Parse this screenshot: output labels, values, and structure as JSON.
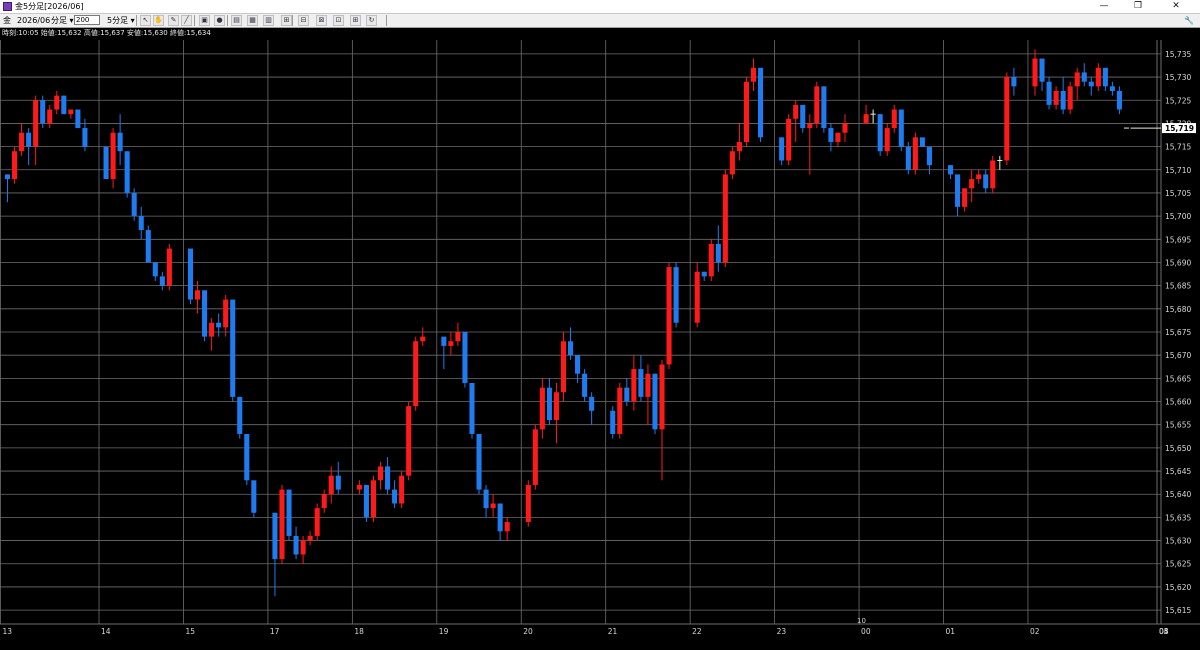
{
  "window": {
    "title": "金5分足[2026/06]",
    "minimize_glyph": "—",
    "maximize_glyph": "❐",
    "close_glyph": "✕"
  },
  "toolbar": {
    "symbol": "金",
    "contract": "2026/06",
    "unit_label": "分足",
    "count_value": "200",
    "timeframe_label": "5分足",
    "button_icons": [
      "cursor-icon",
      "hand-icon",
      "pen-icon",
      "line-draw-icon",
      "chart-select-icon",
      "color-circle-icon",
      "bar-chart-icon",
      "grid-icon",
      "table-icon",
      "indicator-icon",
      "indicator-icon-2",
      "indicator-icon-3",
      "indicator-icon-4",
      "indicator-icon-5",
      "refresh-icon"
    ],
    "settings_icon": "wrench-icon"
  },
  "info_bar": {
    "text": "時刻:10:05 始値:15,632 高値:15,637 安値:15,630 終値:15,634"
  },
  "colors": {
    "background": "#000000",
    "grid": "#6e6e6e",
    "up": "#ff1a1a",
    "down": "#1e7cf0",
    "doji": "#f0ead0",
    "axis_text": "#d8d8d8",
    "price_tag_bg": "#ffffff"
  },
  "chart_data": {
    "type": "candlestick",
    "y_axis": {
      "ticks": [
        15615,
        15620,
        15625,
        15630,
        15635,
        15640,
        15645,
        15650,
        15655,
        15660,
        15665,
        15670,
        15675,
        15680,
        15685,
        15690,
        15695,
        15700,
        15705,
        15710,
        15715,
        15720,
        15725,
        15730,
        15735
      ],
      "tick_labels": [
        "15,615",
        "15,620",
        "15,625",
        "15,630",
        "15,635",
        "15,640",
        "15,645",
        "15,650",
        "15,655",
        "15,660",
        "15,665",
        "15,670",
        "15,675",
        "15,680",
        "15,685",
        "15,690",
        "15,695",
        "15,700",
        "15,705",
        "15,710",
        "15,715",
        "15,720",
        "15,725",
        "15,730",
        "15,735"
      ],
      "range": [
        15612,
        15738
      ]
    },
    "x_axis": {
      "labels": [
        "13",
        "14",
        "15",
        "17",
        "18",
        "19",
        "20",
        "21",
        "22",
        "23",
        "00",
        "01",
        "02",
        "03",
        "04",
        "05"
      ],
      "month_marker": "10",
      "month_marker_at": "00",
      "grid_at": [
        "13",
        "14",
        "15",
        "17",
        "18",
        "19",
        "20",
        "21",
        "22",
        "23",
        "00",
        "01",
        "02",
        "03",
        "04",
        "05"
      ]
    },
    "current_price": 15719,
    "current_price_label": "15,719",
    "candles": [
      [
        15709,
        15709,
        15703,
        15708
      ],
      [
        15708,
        15715,
        15707,
        15714
      ],
      [
        15714,
        15720,
        15713,
        15718
      ],
      [
        15718,
        15719,
        15711,
        15715
      ],
      [
        15715,
        15726,
        15711,
        15725
      ],
      [
        15725,
        15726,
        15719,
        15720
      ],
      [
        15720,
        15724,
        15719,
        15723
      ],
      [
        15723,
        15727,
        15722,
        15726
      ],
      [
        15726,
        15726,
        15722,
        15722
      ],
      [
        15722,
        15723,
        15721,
        15723
      ],
      [
        15723,
        15723,
        15719,
        15719
      ],
      [
        15719,
        15721,
        15714,
        15715
      ],
      [
        15715,
        15715,
        15708,
        15708
      ],
      [
        15708,
        15719,
        15706,
        15718
      ],
      [
        15718,
        15722,
        15711,
        15714
      ],
      [
        15714,
        15714,
        15704,
        15705
      ],
      [
        15705,
        15706,
        15699,
        15700
      ],
      [
        15700,
        15702,
        15695,
        15697
      ],
      [
        15697,
        15698,
        15690,
        15690
      ],
      [
        15690,
        15690,
        15686,
        15687
      ],
      [
        15687,
        15688,
        15684,
        15685
      ],
      [
        15685,
        15694,
        15684,
        15693
      ],
      [
        15693,
        15693,
        15681,
        15682
      ],
      [
        15682,
        15686,
        15679,
        15684
      ],
      [
        15684,
        15684,
        15673,
        15674
      ],
      [
        15674,
        15678,
        15671,
        15677
      ],
      [
        15677,
        15679,
        15674,
        15676
      ],
      [
        15676,
        15683,
        15674,
        15682
      ],
      [
        15682,
        15682,
        15660,
        15661
      ],
      [
        15661,
        15661,
        15652,
        15653
      ],
      [
        15653,
        15653,
        15642,
        15643
      ],
      [
        15643,
        15643,
        15635,
        15636
      ],
      [
        15636,
        15636,
        15618,
        15626
      ],
      [
        15626,
        15642,
        15625,
        15641
      ],
      [
        15641,
        15641,
        15630,
        15631
      ],
      [
        15631,
        15633,
        15626,
        15627
      ],
      [
        15627,
        15631,
        15625,
        15630
      ],
      [
        15630,
        15632,
        15629,
        15631
      ],
      [
        15631,
        15638,
        15630,
        15637
      ],
      [
        15637,
        15641,
        15636,
        15640
      ],
      [
        15640,
        15646,
        15638,
        15644
      ],
      [
        15644,
        15647,
        15640,
        15641
      ],
      [
        15641,
        15643,
        15640,
        15642
      ],
      [
        15642,
        15642,
        15634,
        15635
      ],
      [
        15635,
        15644,
        15634,
        15643
      ],
      [
        15643,
        15647,
        15641,
        15646
      ],
      [
        15646,
        15648,
        15640,
        15641
      ],
      [
        15641,
        15643,
        15637,
        15638
      ],
      [
        15638,
        15645,
        15637,
        15644
      ],
      [
        15644,
        15660,
        15643,
        15659
      ],
      [
        15659,
        15674,
        15658,
        15673
      ],
      [
        15673,
        15676,
        15672,
        15674
      ],
      [
        15674,
        15674,
        15667,
        15672
      ],
      [
        15672,
        15675,
        15670,
        15673
      ],
      [
        15673,
        15677,
        15672,
        15675
      ],
      [
        15675,
        15675,
        15663,
        15664
      ],
      [
        15664,
        15664,
        15652,
        15653
      ],
      [
        15653,
        15653,
        15640,
        15641
      ],
      [
        15641,
        15642,
        15635,
        15637
      ],
      [
        15637,
        15640,
        15635,
        15638
      ],
      [
        15638,
        15638,
        15630,
        15632
      ],
      [
        15632,
        15635,
        15630,
        15634
      ],
      [
        15634,
        15643,
        15633,
        15642
      ],
      [
        15642,
        15655,
        15641,
        15654
      ],
      [
        15654,
        15665,
        15652,
        15663
      ],
      [
        15663,
        15665,
        15655,
        15656
      ],
      [
        15656,
        15664,
        15651,
        15662
      ],
      [
        15662,
        15675,
        15660,
        15673
      ],
      [
        15673,
        15676,
        15669,
        15670
      ],
      [
        15670,
        15670,
        15664,
        15666
      ],
      [
        15666,
        15667,
        15660,
        15661
      ],
      [
        15661,
        15662,
        15655,
        15658
      ],
      [
        15658,
        15659,
        15652,
        15653
      ],
      [
        15653,
        15664,
        15652,
        15663
      ],
      [
        15663,
        15665,
        15659,
        15660
      ],
      [
        15660,
        15670,
        15658,
        15667
      ],
      [
        15667,
        15670,
        15660,
        15661
      ],
      [
        15661,
        15668,
        15655,
        15666
      ],
      [
        15666,
        15666,
        15653,
        15654
      ],
      [
        15654,
        15669,
        15643,
        15668
      ],
      [
        15668,
        15690,
        15667,
        15689
      ],
      [
        15689,
        15690,
        15676,
        15677
      ],
      [
        15677,
        15690,
        15676,
        15688
      ],
      [
        15688,
        15688,
        15686,
        15687
      ],
      [
        15687,
        15695,
        15686,
        15694
      ],
      [
        15694,
        15698,
        15688,
        15690
      ],
      [
        15690,
        15710,
        15689,
        15709
      ],
      [
        15709,
        15715,
        15708,
        15714
      ],
      [
        15714,
        15720,
        15712,
        15716
      ],
      [
        15716,
        15730,
        15715,
        15729
      ],
      [
        15729,
        15734,
        15727,
        15732
      ],
      [
        15732,
        15732,
        15716,
        15717
      ],
      [
        15717,
        15717,
        15711,
        15712
      ],
      [
        15712,
        15722,
        15711,
        15721
      ],
      [
        15721,
        15725,
        15716,
        15724
      ],
      [
        15724,
        15724,
        15718,
        15719
      ],
      [
        15719,
        15722,
        15709,
        15720
      ],
      [
        15720,
        15729,
        15719,
        15728
      ],
      [
        15728,
        15728,
        15718,
        15719
      ],
      [
        15719,
        15720,
        15714,
        15716
      ],
      [
        15716,
        15718,
        15715,
        15718
      ],
      [
        15718,
        15722,
        15716,
        15720
      ],
      [
        15720,
        15724,
        15720,
        15722
      ],
      [
        15722,
        15723,
        15720,
        15722
      ],
      [
        15722,
        15722,
        15713,
        15714
      ],
      [
        15714,
        15720,
        15713,
        15719
      ],
      [
        15719,
        15724,
        15718,
        15723
      ],
      [
        15723,
        15723,
        15714,
        15715
      ],
      [
        15715,
        15716,
        15709,
        15710
      ],
      [
        15710,
        15718,
        15709,
        15717
      ],
      [
        15717,
        15716,
        15715,
        15715
      ],
      [
        15715,
        15715,
        15709,
        15711
      ],
      [
        15711,
        15711,
        15708,
        15709
      ],
      [
        15709,
        15709,
        15700,
        15702
      ],
      [
        15702,
        15706,
        15701,
        15706
      ],
      [
        15706,
        15710,
        15703,
        15708
      ],
      [
        15708,
        15710,
        15707,
        15709
      ],
      [
        15709,
        15710,
        15705,
        15706
      ],
      [
        15706,
        15713,
        15705,
        15712
      ],
      [
        15712,
        15713,
        15710,
        15712
      ],
      [
        15712,
        15731,
        15711,
        15730
      ],
      [
        15730,
        15732,
        15726,
        15728
      ],
      [
        15728,
        15736,
        15726,
        15734
      ],
      [
        15734,
        15734,
        15727,
        15729
      ],
      [
        15729,
        15730,
        15723,
        15724
      ],
      [
        15724,
        15728,
        15723,
        15727
      ],
      [
        15727,
        15730,
        15722,
        15723
      ],
      [
        15723,
        15729,
        15722,
        15728
      ],
      [
        15728,
        15732,
        15725,
        15731
      ],
      [
        15731,
        15733,
        15728,
        15729
      ],
      [
        15729,
        15730,
        15726,
        15728
      ],
      [
        15728,
        15733,
        15727,
        15732
      ],
      [
        15732,
        15732,
        15727,
        15728
      ],
      [
        15728,
        15729,
        15726,
        15727
      ],
      [
        15727,
        15728,
        15722,
        15723
      ],
      [
        15719,
        15719,
        15719,
        15719
      ]
    ],
    "gaps_after": [
      [
        11,
        2
      ],
      [
        21,
        2
      ],
      [
        31,
        2
      ],
      [
        41,
        2
      ],
      [
        51,
        2
      ],
      [
        61,
        2
      ],
      [
        71,
        2
      ],
      [
        81,
        2
      ],
      [
        91,
        2
      ],
      [
        101,
        2
      ],
      [
        111,
        2
      ],
      [
        121,
        2
      ]
    ]
  }
}
